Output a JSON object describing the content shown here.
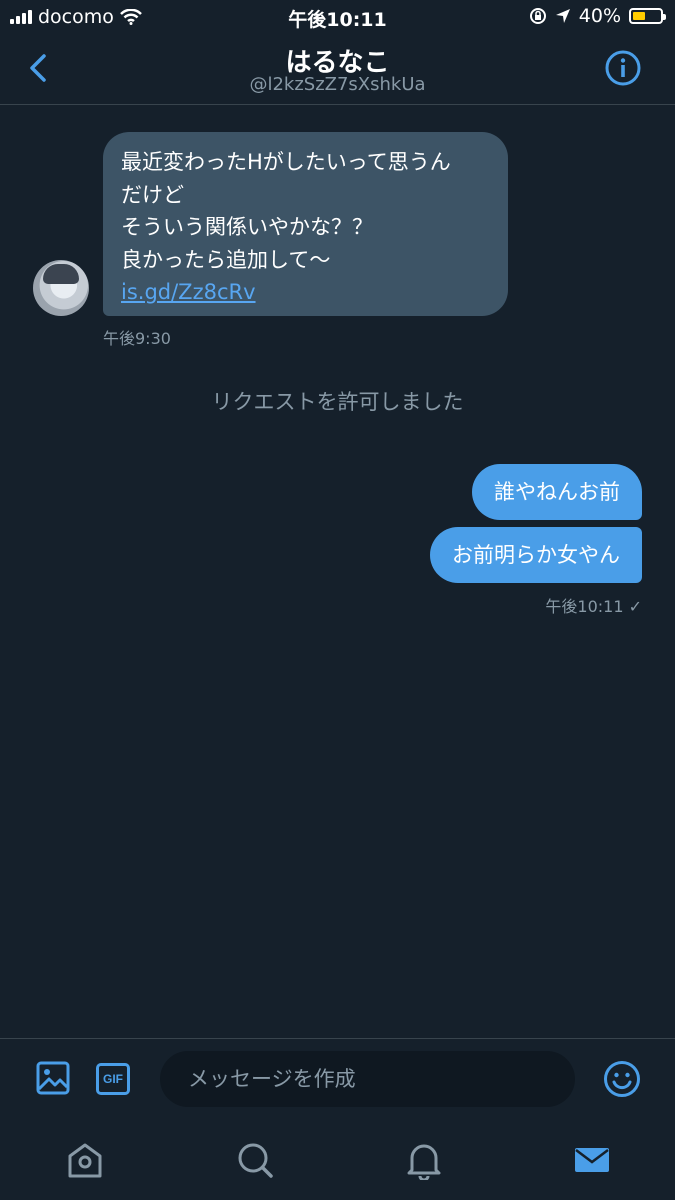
{
  "status_bar": {
    "carrier": "docomo",
    "time": "午後10:11",
    "battery_percent": "40%",
    "battery_level": 0.4
  },
  "header": {
    "name": "はるなこ",
    "handle": "@l2kzSzZ7sXshkUa"
  },
  "messages": {
    "incoming": {
      "lines": [
        "最近変わったHがしたいって思うん",
        "だけど",
        "そういう関係いやかな？？",
        "良かったら追加して〜"
      ],
      "link": "is.gd/Zz8cRv",
      "time": "午後9:30"
    },
    "system_notice": "リクエストを許可しました",
    "outgoing": [
      {
        "text": "誰やねんお前"
      },
      {
        "text": "お前明らか女やん"
      }
    ],
    "outgoing_time": "午後10:11 ✓"
  },
  "compose": {
    "gif_label": "GIF",
    "placeholder": "メッセージを作成"
  },
  "tabs": [
    "home",
    "search",
    "notifications",
    "messages"
  ],
  "colors": {
    "background": "#15202b",
    "accent": "#4a9ee8",
    "incoming_bubble": "#3d5466",
    "secondary_text": "#8899a6"
  }
}
